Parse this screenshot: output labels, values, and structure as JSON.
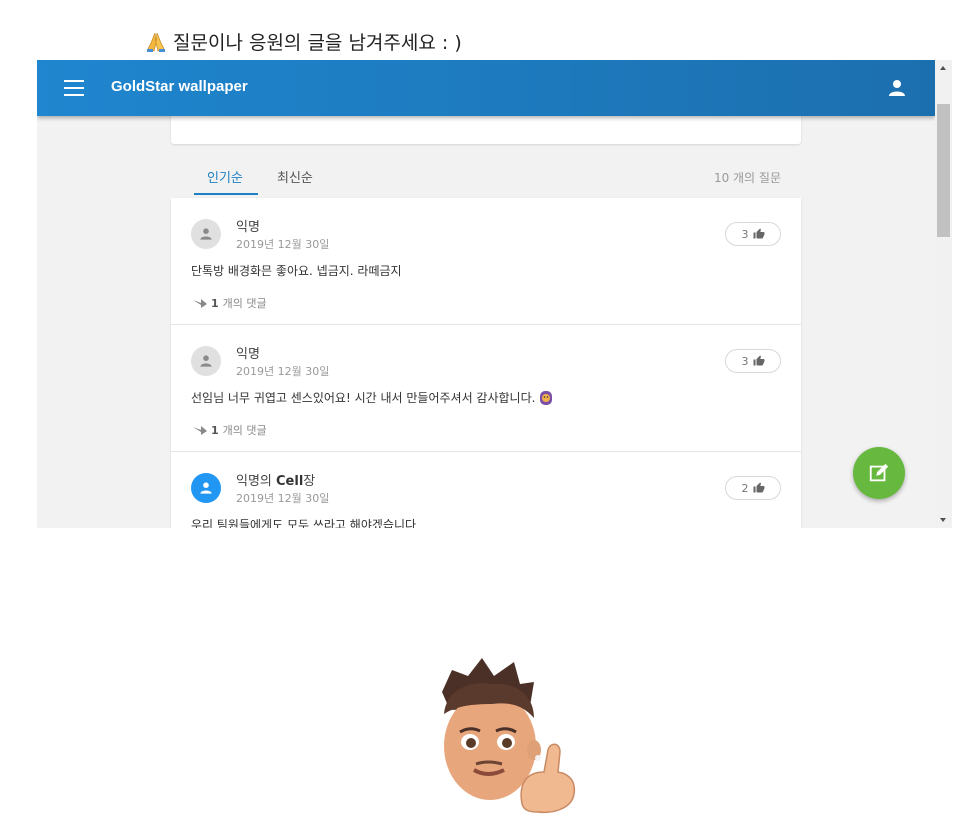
{
  "heading": {
    "text": "질문이나 응원의 글을 남겨주세요 : )"
  },
  "appbar": {
    "title": "GoldStar wallpaper"
  },
  "tabs": {
    "popular": "인기순",
    "recent": "최신순",
    "count": "10 개의 질문"
  },
  "questions": [
    {
      "author": "익명",
      "author_bold": "",
      "date": "2019년 12월 30일",
      "likes": "3",
      "text": "단톡방 배경화믄 좋아요. 넵금지. 라떼금지",
      "reply_count": "1",
      "reply_label": "개의 댓글",
      "avatar_color": "#e0e0e0"
    },
    {
      "author": "익명",
      "author_bold": "",
      "date": "2019년 12월 30일",
      "likes": "3",
      "text": "선임님 너무 귀엽고 센스있어요! 시간 내서 만들어주셔서 감사합니다.",
      "reply_count": "1",
      "reply_label": "개의 댓글",
      "avatar_color": "#e0e0e0"
    },
    {
      "author": "익명의 ",
      "author_bold": "Cell",
      "author_suffix": "장",
      "date": "2019년 12월 30일",
      "likes": "2",
      "text": "우리 팀원들에게도 모두 쓰라고 해야겠습니다",
      "avatar_color": "#2196f3"
    }
  ],
  "colors": {
    "appbar": "#1f86cf",
    "fab": "#66b83e",
    "tab_active": "#1f7fc2"
  }
}
